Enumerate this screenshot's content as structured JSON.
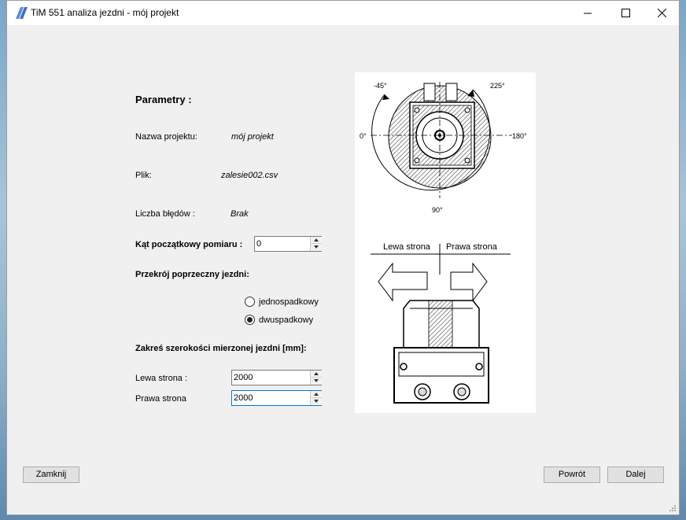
{
  "window": {
    "title": "TiM 551 analiza jezdni - mój projekt",
    "accent_color": "#5b8bd9"
  },
  "params": {
    "heading": "Parametry :",
    "project_name_label": "Nazwa projektu:",
    "project_name_value": "mój projekt",
    "file_label": "Plik:",
    "file_value": "zalesie002.csv",
    "errors_label": "Liczba błędów :",
    "errors_value": "Brak",
    "start_angle_label": "Kąt początkowy pomiaru :",
    "start_angle_value": "0"
  },
  "cross_section": {
    "heading": "Przekrój poprzeczny jezdni:",
    "options": [
      {
        "label": "jednospadkowy",
        "checked": false
      },
      {
        "label": "dwuspadkowy",
        "checked": true
      }
    ]
  },
  "width_range": {
    "heading": "Zakreś szerokości mierzonej jezdni [mm]:",
    "left_label": "Lewa strona :",
    "left_value": "2000",
    "right_label": "Prawa strona",
    "right_value": "2000"
  },
  "diagram": {
    "angle_minus45": "-45°",
    "angle_225": "225°",
    "angle_0": "0°",
    "angle_180": "180°",
    "angle_90": "90°",
    "left_side": "Lewa strona",
    "right_side": "Prawa strona"
  },
  "buttons": {
    "close": "Zamknij",
    "back": "Powrót",
    "next": "Dalej"
  }
}
